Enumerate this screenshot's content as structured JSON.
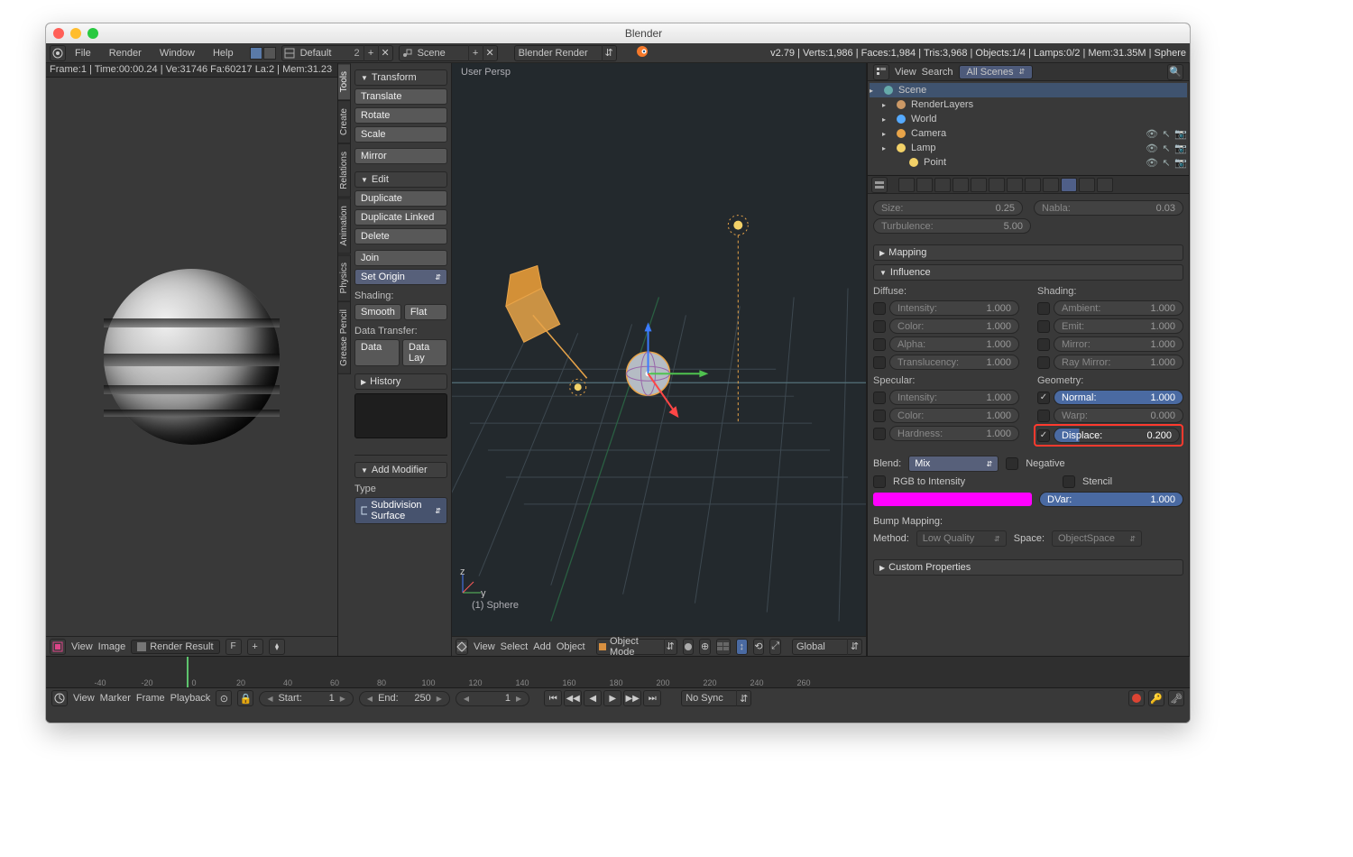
{
  "window": {
    "title": "Blender"
  },
  "menubar": {
    "items": [
      "File",
      "Render",
      "Window",
      "Help"
    ],
    "layout_field": "Default",
    "scene_field": "Scene",
    "engine": "Blender Render",
    "stats": "v2.79 | Verts:1,986 | Faces:1,984 | Tris:3,968 | Objects:1/4 | Lamps:0/2 | Mem:31.35M | Sphere"
  },
  "uv_editor": {
    "header_stats": "Frame:1 | Time:00:00.24 | Ve:31746 Fa:60217 La:2 | Mem:31.23",
    "footer": {
      "view": "View",
      "image": "Image",
      "slot": "Render Result",
      "f": "F"
    }
  },
  "toolshelf": {
    "tabs": [
      "Tools",
      "Create",
      "Relations",
      "Animation",
      "Physics",
      "Grease Pencil"
    ],
    "transform": {
      "head": "Transform",
      "translate": "Translate",
      "rotate": "Rotate",
      "scale": "Scale",
      "mirror": "Mirror"
    },
    "edit": {
      "head": "Edit",
      "duplicate": "Duplicate",
      "duplicate_linked": "Duplicate Linked",
      "delete": "Delete",
      "join": "Join",
      "set_origin": "Set Origin",
      "shading_label": "Shading:",
      "smooth": "Smooth",
      "flat": "Flat",
      "dtrans_label": "Data Transfer:",
      "data": "Data",
      "data_lay": "Data Lay"
    },
    "history_head": "History",
    "modifier": {
      "head": "Add Modifier",
      "type_label": "Type",
      "type_value": "Subdivision Surface"
    }
  },
  "viewport": {
    "persp": "User Persp",
    "obj_label": "(1) Sphere",
    "menu": [
      "View",
      "Select",
      "Add",
      "Object"
    ],
    "mode": "Object Mode",
    "orient": "Global"
  },
  "outliner": {
    "hdr": {
      "view": "View",
      "search": "Search",
      "filter": "All Scenes"
    },
    "rows": [
      {
        "name": "Scene",
        "lvl": 0,
        "sel": true,
        "icon": "scene"
      },
      {
        "name": "RenderLayers",
        "lvl": 1,
        "icon": "render"
      },
      {
        "name": "World",
        "lvl": 1,
        "icon": "world"
      },
      {
        "name": "Camera",
        "lvl": 1,
        "icon": "camera",
        "eye": true
      },
      {
        "name": "Lamp",
        "lvl": 1,
        "icon": "lamp",
        "eye": true
      },
      {
        "name": "Point",
        "lvl": 2,
        "icon": "lamp",
        "eye": true
      }
    ]
  },
  "props": {
    "size": {
      "label": "Size:",
      "value": "0.25"
    },
    "nabla": {
      "label": "Nabla:",
      "value": "0.03"
    },
    "turb": {
      "label": "Turbulence:",
      "value": "5.00"
    },
    "mapping_head": "Mapping",
    "influence_head": "Influence",
    "custom_head": "Custom Properties",
    "diffuse": {
      "head": "Diffuse:",
      "rows": [
        {
          "label": "Intensity:",
          "value": "1.000",
          "on": false
        },
        {
          "label": "Color:",
          "value": "1.000",
          "on": false
        },
        {
          "label": "Alpha:",
          "value": "1.000",
          "on": false
        },
        {
          "label": "Translucency:",
          "value": "1.000",
          "on": false
        }
      ]
    },
    "specular": {
      "head": "Specular:",
      "rows": [
        {
          "label": "Intensity:",
          "value": "1.000",
          "on": false
        },
        {
          "label": "Color:",
          "value": "1.000",
          "on": false
        },
        {
          "label": "Hardness:",
          "value": "1.000",
          "on": false
        }
      ]
    },
    "shading": {
      "head": "Shading:",
      "rows": [
        {
          "label": "Ambient:",
          "value": "1.000",
          "on": false
        },
        {
          "label": "Emit:",
          "value": "1.000",
          "on": false
        },
        {
          "label": "Mirror:",
          "value": "1.000",
          "on": false
        },
        {
          "label": "Ray Mirror:",
          "value": "1.000",
          "on": false
        }
      ]
    },
    "geometry": {
      "head": "Geometry:",
      "normal": {
        "label": "Normal:",
        "value": "1.000",
        "on": true,
        "fill": "100%"
      },
      "warp": {
        "label": "Warp:",
        "value": "0.000",
        "on": false
      },
      "disp": {
        "label": "Displace:",
        "value": "0.200",
        "on": true,
        "fill": "20%"
      }
    },
    "blend": {
      "label": "Blend:",
      "value": "Mix",
      "negative": "Negative",
      "rgbint": "RGB to Intensity",
      "stencil": "Stencil",
      "dvar": {
        "label": "DVar:",
        "value": "1.000"
      }
    },
    "bump": {
      "head": "Bump Mapping:",
      "method_label": "Method:",
      "method": "Low Quality",
      "space_label": "Space:",
      "space": "ObjectSpace"
    }
  },
  "timeline": {
    "ticks": [
      "-40",
      "-20",
      "0",
      "20",
      "40",
      "60",
      "80",
      "100",
      "120",
      "140",
      "160",
      "180",
      "200",
      "220",
      "240",
      "260"
    ],
    "hdr": {
      "view": "View",
      "marker": "Marker",
      "frame": "Frame",
      "playback": "Playback",
      "start_label": "Start:",
      "start": "1",
      "end_label": "End:",
      "end": "250",
      "cur": "1",
      "sync": "No Sync"
    }
  }
}
